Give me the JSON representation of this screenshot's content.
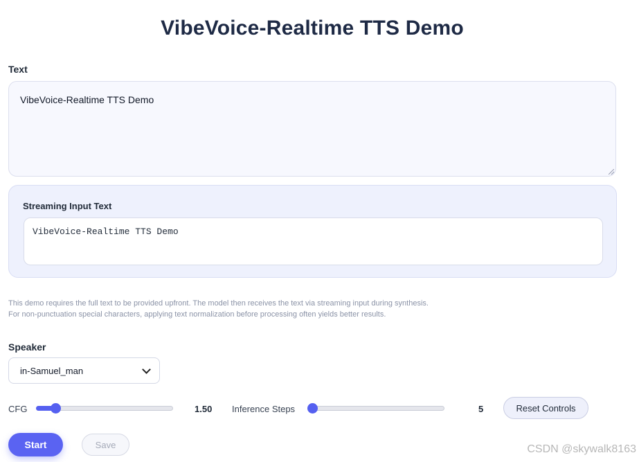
{
  "app": {
    "title": "VibeVoice-Realtime TTS Demo"
  },
  "text_section": {
    "label": "Text",
    "value": "VibeVoice-Realtime TTS Demo"
  },
  "streaming_section": {
    "label": "Streaming Input Text",
    "value": "VibeVoice-Realtime TTS Demo"
  },
  "notes": {
    "line1": "This demo requires the full text to be provided upfront. The model then receives the text via streaming input during synthesis.",
    "line2": "For non-punctuation special characters, applying text normalization before processing often yields better results."
  },
  "speaker": {
    "label": "Speaker",
    "selected": "in-Samuel_man",
    "icon": "chevron-down-icon"
  },
  "controls": {
    "cfg": {
      "label": "CFG",
      "value_text": "1.50",
      "fraction": 0.14
    },
    "steps": {
      "label": "Inference Steps",
      "value_text": "5",
      "fraction": 0.0
    },
    "reset_label": "Reset Controls"
  },
  "actions": {
    "start_label": "Start",
    "save_label": "Save"
  },
  "watermark": "CSDN @skywalk8163",
  "colors": {
    "accent": "#5a63f2",
    "title": "#1e2a45",
    "panel": "#eef1fd"
  }
}
